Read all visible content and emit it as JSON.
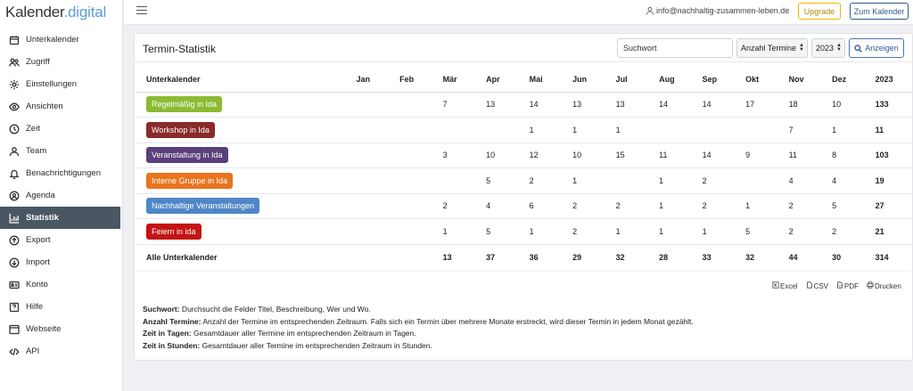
{
  "app": {
    "logo_main": "Kalender",
    "logo_accent": ".digital"
  },
  "sidebar": {
    "items": [
      {
        "label": "Unterkalender",
        "icon": "calendar-icon"
      },
      {
        "label": "Zugriff",
        "icon": "users-icon"
      },
      {
        "label": "Einstellungen",
        "icon": "gear-icon"
      },
      {
        "label": "Ansichten",
        "icon": "eye-icon"
      },
      {
        "label": "Zeit",
        "icon": "clock-icon"
      },
      {
        "label": "Team",
        "icon": "user-icon"
      },
      {
        "label": "Benachrichtigungen",
        "icon": "bell-icon"
      },
      {
        "label": "Agenda",
        "icon": "agenda-icon"
      },
      {
        "label": "Statistik",
        "icon": "chart-icon"
      },
      {
        "label": "Export",
        "icon": "upload-icon"
      },
      {
        "label": "Import",
        "icon": "download-icon"
      },
      {
        "label": "Konto",
        "icon": "id-card-icon"
      },
      {
        "label": "Hilfe",
        "icon": "help-icon"
      },
      {
        "label": "Webseite",
        "icon": "browser-icon"
      },
      {
        "label": "API",
        "icon": "code-icon"
      }
    ],
    "active_index": 8
  },
  "header": {
    "user_email": "info@nachhaltig-zusammen-leben.de",
    "upgrade_label": "Upgrade",
    "kalender_label": "Zum Kalender"
  },
  "stats": {
    "title": "Termin-Statistik",
    "search_placeholder": "Suchwort",
    "metric_value": "Anzahl Termine",
    "year_value": "2023",
    "show_label": "Anzeigen",
    "columns": [
      "Unterkalender",
      "Jan",
      "Feb",
      "Mär",
      "Apr",
      "Mai",
      "Jun",
      "Jul",
      "Aug",
      "Sep",
      "Okt",
      "Nov",
      "Dez",
      "2023"
    ],
    "rows": [
      {
        "name": "Regelmäßig in Ida",
        "color": "#8bba33",
        "values": [
          "",
          "",
          "7",
          "13",
          "14",
          "13",
          "13",
          "14",
          "14",
          "17",
          "18",
          "10",
          "133"
        ]
      },
      {
        "name": "Workshop in Ida",
        "color": "#8a2a2a",
        "values": [
          "",
          "",
          "",
          "",
          "1",
          "1",
          "1",
          "",
          "",
          "",
          "7",
          "1",
          "11"
        ]
      },
      {
        "name": "Veranstaltung in Ida",
        "color": "#5b3f7a",
        "values": [
          "",
          "",
          "3",
          "10",
          "12",
          "10",
          "15",
          "11",
          "14",
          "9",
          "11",
          "8",
          "103"
        ]
      },
      {
        "name": "Interne Gruppe in Ida",
        "color": "#e8741e",
        "values": [
          "",
          "",
          "",
          "5",
          "2",
          "1",
          "",
          "1",
          "2",
          "",
          "4",
          "4",
          "19"
        ]
      },
      {
        "name": "Nachhaltige Veranstaltungen",
        "color": "#4f86c6",
        "values": [
          "",
          "",
          "2",
          "4",
          "6",
          "2",
          "2",
          "1",
          "2",
          "1",
          "2",
          "5",
          "27"
        ]
      },
      {
        "name": "Feiern in ida",
        "color": "#c41414",
        "values": [
          "",
          "",
          "1",
          "5",
          "1",
          "2",
          "1",
          "1",
          "1",
          "5",
          "2",
          "2",
          "21"
        ]
      }
    ],
    "total": {
      "name": "Alle Unterkalender",
      "values": [
        "",
        "",
        "13",
        "37",
        "36",
        "29",
        "32",
        "28",
        "33",
        "32",
        "44",
        "30",
        "314"
      ]
    },
    "exports": [
      "Excel",
      "CSV",
      "PDF",
      "Drucken"
    ],
    "legend": [
      {
        "term": "Suchwort:",
        "text": " Durchsucht die Felder Titel, Beschreibung, Wer und Wo."
      },
      {
        "term": "Anzahl Termine:",
        "text": " Anzahl der Termine im entsprechenden Zeitraum. Falls sich ein Termin über mehrere Monate erstreckt, wird dieser Termin in jedem Monat gezählt."
      },
      {
        "term": "Zeit in Tagen:",
        "text": " Gesamtdauer aller Termine im entsprechenden Zeitraum in Tagen."
      },
      {
        "term": "Zeit in Stunden:",
        "text": " Gesamtdauer aller Termine im entsprechenden Zeitraum in Stunden."
      }
    ]
  }
}
